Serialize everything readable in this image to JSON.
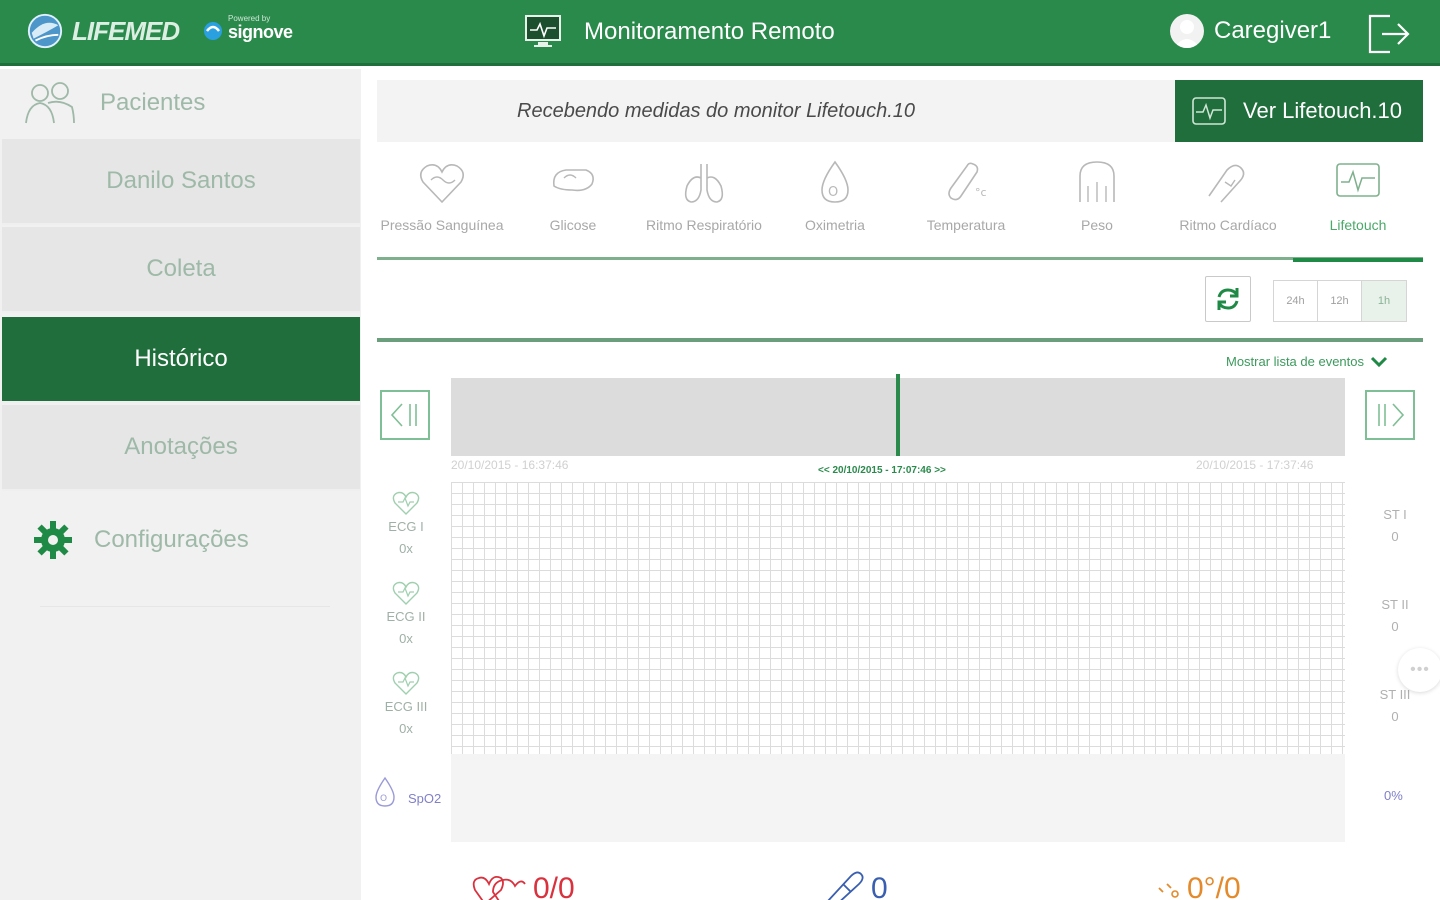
{
  "header": {
    "brand": "LIFEMED",
    "powered_by": "Powered by",
    "partner": "signove",
    "title": "Monitoramento Remoto",
    "user": "Caregiver1"
  },
  "sidebar": {
    "section_label": "Pacientes",
    "items": [
      {
        "label": "Danilo Santos",
        "active": false
      },
      {
        "label": "Coleta",
        "active": false
      },
      {
        "label": "Histórico",
        "active": true
      },
      {
        "label": "Anotações",
        "active": false
      }
    ],
    "settings_label": "Configurações"
  },
  "status": {
    "text": "Recebendo medidas do monitor Lifetouch.10",
    "button_label": "Ver Lifetouch.10"
  },
  "tabs": [
    {
      "label": "Pressão Sanguínea",
      "icon": "heart-bp-icon"
    },
    {
      "label": "Glicose",
      "icon": "glucose-icon"
    },
    {
      "label": "Ritmo Respiratório",
      "icon": "lungs-icon"
    },
    {
      "label": "Oximetria",
      "icon": "oxygen-drop-icon"
    },
    {
      "label": "Temperatura",
      "icon": "thermometer-icon"
    },
    {
      "label": "Peso",
      "icon": "scale-icon"
    },
    {
      "label": "Ritmo Cardíaco",
      "icon": "heart-rate-icon"
    },
    {
      "label": "Lifetouch",
      "icon": "lifetouch-icon",
      "active": true
    }
  ],
  "ranges": [
    "24h",
    "12h",
    "1h"
  ],
  "active_range": "1h",
  "events_link": "Mostrar lista de eventos",
  "timeline": {
    "start": "20/10/2015 - 16:37:46",
    "current": "<< 20/10/2015 - 17:07:46 >>",
    "end": "20/10/2015 - 17:37:46"
  },
  "ecg": [
    {
      "label": "ECG I",
      "value": "0x"
    },
    {
      "label": "ECG II",
      "value": "0x"
    },
    {
      "label": "ECG III",
      "value": "0x"
    }
  ],
  "st": [
    {
      "label": "ST I",
      "value": "0"
    },
    {
      "label": "ST II",
      "value": "0"
    },
    {
      "label": "ST III",
      "value": "0"
    }
  ],
  "spo2": {
    "label": "SpO2",
    "value": "0%"
  },
  "more": "•••",
  "bottom": [
    {
      "icon": "heart-bp-icon",
      "value": "0/0",
      "color": "#d9323e"
    },
    {
      "icon": "glucose-icon",
      "value": "0",
      "color": "#3a5fb0"
    },
    {
      "icon": "thermometer-icon",
      "value": "0°/0",
      "color": "#e48a2a"
    }
  ],
  "colors": {
    "header_green": "#2a8a4b",
    "active_green": "#1f6e3b"
  }
}
